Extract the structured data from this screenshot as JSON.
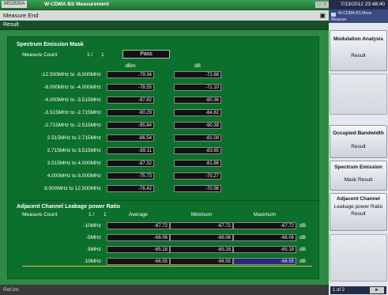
{
  "window": {
    "badge": "MS2830A",
    "title": "W-CDMA BS Measurement",
    "max_icon": "□",
    "close_icon": "×"
  },
  "status_top": {
    "text": "Measure End",
    "corner_icon": "▣"
  },
  "result_tab": "Result",
  "sem": {
    "title": "Spectrum Emission Mask",
    "measure_count_label": "Measure Count",
    "measure_count_value": "1 /",
    "measure_count_total": "1",
    "judgement": "Pass",
    "col_dbm": "dBm",
    "col_db": "dB",
    "rows": [
      {
        "range": "-12.500MHz to -8.000MHz",
        "dbm": "-79.34",
        "db": "-72.88"
      },
      {
        "range": "-8.000MHz to -4.000MHz",
        "dbm": "-78.55",
        "db": "-71.10"
      },
      {
        "range": "-4.000MHz to -3.515MHz",
        "dbm": "-87.82",
        "db": "-80.36"
      },
      {
        "range": "-3.515MHz to -2.715MHz",
        "dbm": "-90.29",
        "db": "-84.82"
      },
      {
        "range": "-2.715MHz to -2.515MHz",
        "dbm": "-95.84",
        "db": "-90.38"
      },
      {
        "range": "2.515MHz to 2.715MHz",
        "dbm": "-86.54",
        "db": "-81.08"
      },
      {
        "range": "2.715MHz to 3.515MHz",
        "dbm": "-89.11",
        "db": "-83.65"
      },
      {
        "range": "3.515MHz to 4.000MHz",
        "dbm": "-87.32",
        "db": "-81.86"
      },
      {
        "range": "4.000MHz to 8.000MHz",
        "dbm": "-75.73",
        "db": "-70.27"
      },
      {
        "range": "8.000MHz to 12.500MHz",
        "dbm": "-76.42",
        "db": "-70.96"
      }
    ]
  },
  "aclr": {
    "title": "Adjacent Channel Leakage power Ratio",
    "measure_count_label": "Measure Count",
    "measure_count_value": "1 /",
    "measure_count_total": "1",
    "col_average": "Average",
    "col_minimum": "Minimum",
    "col_maximum": "Maximum",
    "unit": "dB",
    "rows": [
      {
        "offset": "-10MHz",
        "average": "-67.72",
        "minimum": "-67.72",
        "maximum": "-67.72"
      },
      {
        "offset": "-5MHz",
        "average": "-66.06",
        "minimum": "-66.06",
        "maximum": "-66.06"
      },
      {
        "offset": "5MHz",
        "average": "-65.18",
        "minimum": "-65.18",
        "maximum": "-65.18"
      },
      {
        "offset": "10MHz",
        "average": "-66.55",
        "minimum": "-66.55",
        "maximum": "-66.55"
      }
    ]
  },
  "status_bottom": "Ref.Int",
  "right_panel": {
    "clock": "7/13/2012 23:48:40",
    "app_title": "W-CDMA BS Meas",
    "app_sub": "Measure",
    "softkeys": [
      {
        "title": "Modulation Analysis",
        "sub": "Result"
      },
      {
        "title": "Occupied Bandwidth",
        "sub": "Result"
      },
      {
        "title": "Spectrum Emission",
        "sub": "Mask Result"
      },
      {
        "title": "Adjacent Channel",
        "sub": "Leakage power Ratio Result"
      }
    ],
    "page": "1 of 2",
    "next_icon": "►"
  },
  "colors": {
    "window_green": "#2e8a44",
    "panel_green": "#0d6f2c",
    "highlight_blue": "#2a2a7a",
    "acl_marker": "#e7c23a"
  }
}
